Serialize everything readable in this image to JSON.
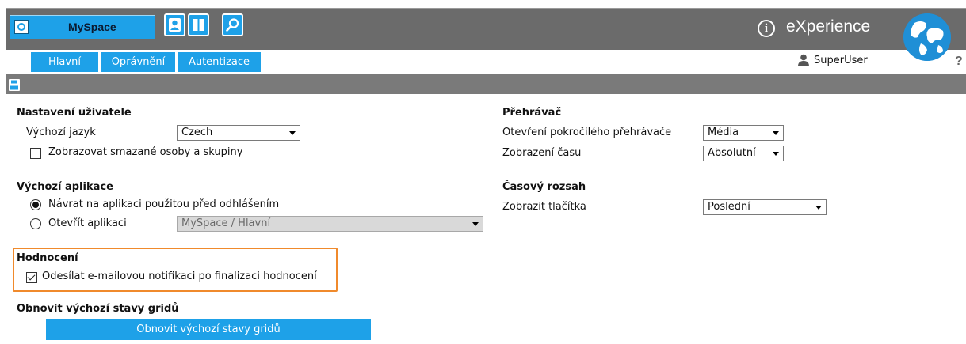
{
  "header": {
    "app_tab_label": "MySpace",
    "brand": "eXperience",
    "info_icon_glyph": "i",
    "user_name": "SuperUser",
    "help_glyph": "?",
    "icons": [
      "app-icon",
      "person-card-icon",
      "split-view-icon",
      "search-icon",
      "info-icon",
      "globe-logo",
      "user-icon",
      "help-icon",
      "save-icon"
    ]
  },
  "tabs": [
    {
      "label": "Hlavní",
      "active": true
    },
    {
      "label": "Oprávnění",
      "active": false
    },
    {
      "label": "Autentizace",
      "active": false
    }
  ],
  "user_settings": {
    "title": "Nastavení uživatele",
    "language_label": "Výchozí jazyk",
    "language_value": "Czech",
    "show_deleted_label": "Zobrazovat smazané osoby a skupiny",
    "show_deleted_checked": false
  },
  "default_app": {
    "title": "Výchozí aplikace",
    "option_return_label": "Návrat na aplikaci použitou před odhlášením",
    "option_return_selected": true,
    "option_open_label": "Otevřít aplikaci",
    "option_open_selected": false,
    "open_app_value": "MySpace / Hlavní"
  },
  "rating": {
    "title": "Hodnocení",
    "email_notify_label": "Odesílat e-mailovou notifikaci po finalizaci hodnocení",
    "email_notify_checked": true
  },
  "grid_reset": {
    "title": "Obnovit výchozí stavy gridů",
    "button_label": "Obnovit výchozí stavy gridů"
  },
  "player": {
    "title": "Přehrávač",
    "advanced_player_label": "Otevření pokročilého přehrávače",
    "advanced_player_value": "Média",
    "time_display_label": "Zobrazení času",
    "time_display_value": "Absolutní"
  },
  "time_range": {
    "title": "Časový rozsah",
    "show_buttons_label": "Zobrazit tlačítka",
    "show_buttons_value": "Poslední"
  },
  "colors": {
    "accent_blue": "#1ea1e8",
    "header_gray": "#6b6b6b",
    "toolbar_gray": "#7a7a7a",
    "highlight_orange": "#f08a2c"
  }
}
